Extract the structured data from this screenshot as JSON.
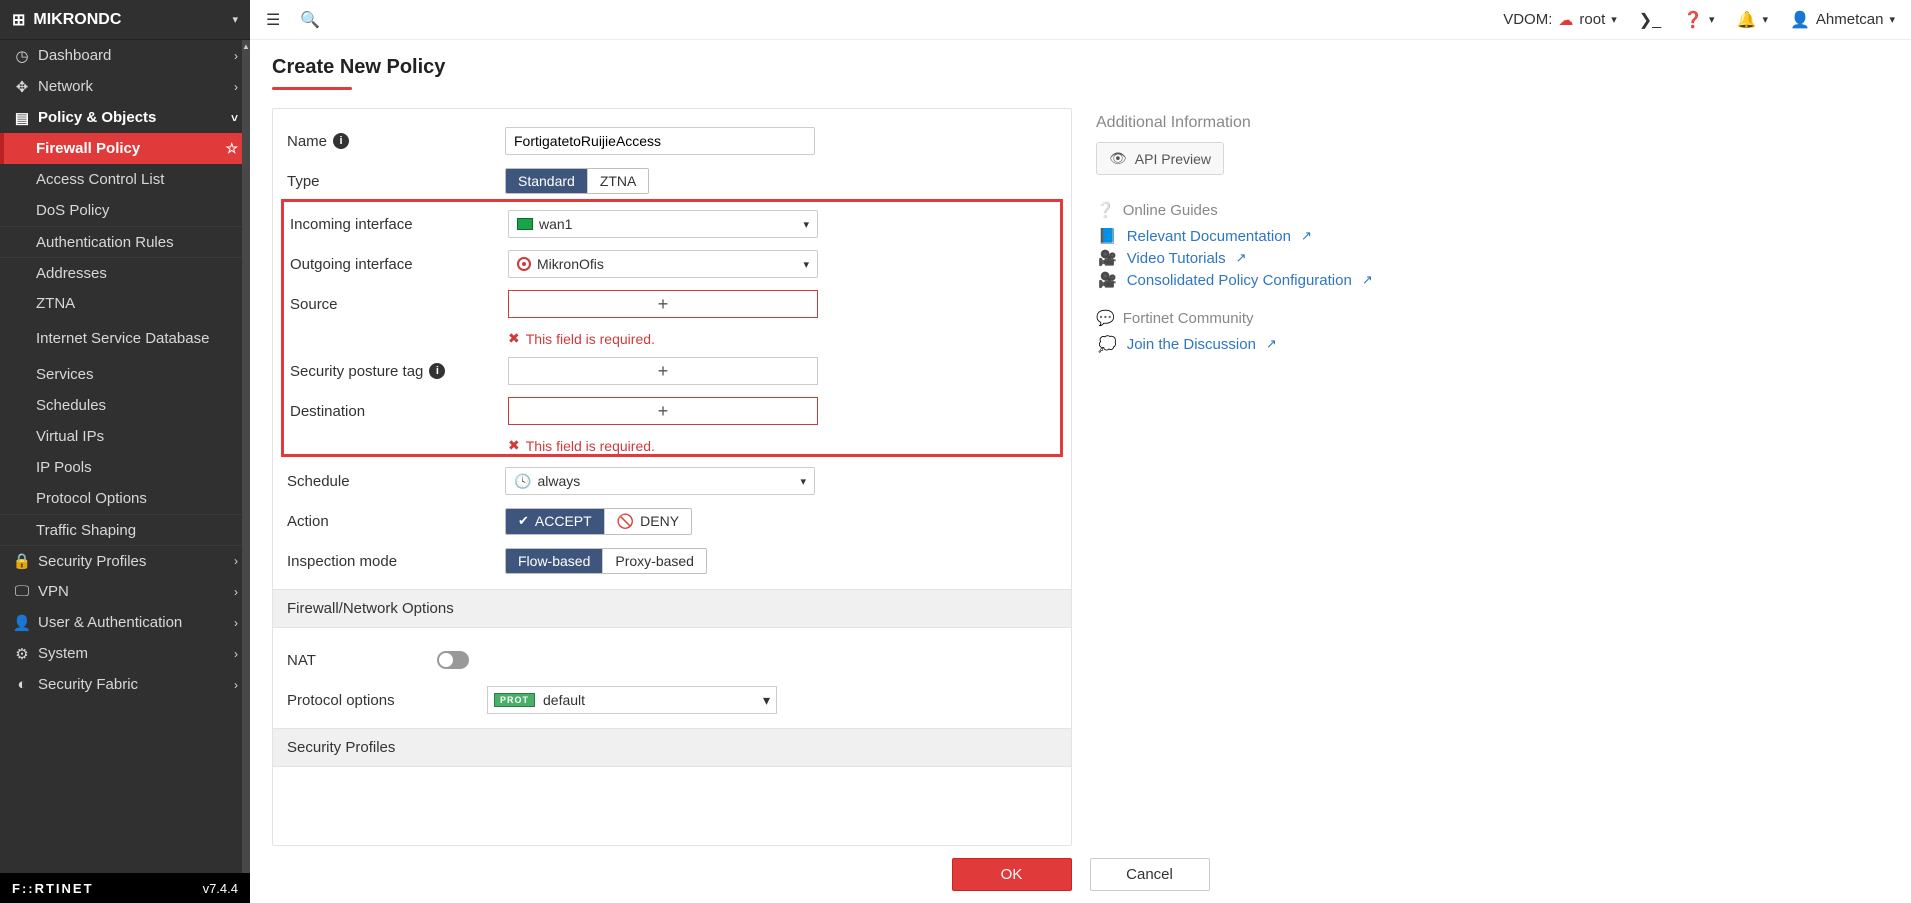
{
  "brand": {
    "name": "MIKRONDC"
  },
  "sidebar": {
    "items": [
      {
        "icon": "🧭",
        "label": "Dashboard",
        "chev": "›"
      },
      {
        "icon": "✥",
        "label": "Network",
        "chev": "›"
      },
      {
        "icon": "🗄",
        "label": "Policy & Objects",
        "chev": "˅",
        "active": true
      },
      {
        "sub": true,
        "label": "Firewall Policy",
        "selected": true,
        "star": true
      },
      {
        "sub": true,
        "label": "Access Control List"
      },
      {
        "sub": true,
        "label": "DoS Policy"
      },
      {
        "sub": true,
        "sep": true,
        "label": "Authentication Rules"
      },
      {
        "sub": true,
        "sep": true,
        "label": "Addresses"
      },
      {
        "sub": true,
        "label": "ZTNA"
      },
      {
        "sub": true,
        "label": "Internet Service Database"
      },
      {
        "sub": true,
        "label": "Services"
      },
      {
        "sub": true,
        "label": "Schedules"
      },
      {
        "sub": true,
        "label": "Virtual IPs"
      },
      {
        "sub": true,
        "label": "IP Pools"
      },
      {
        "sub": true,
        "label": "Protocol Options"
      },
      {
        "sub": true,
        "sep": true,
        "label": "Traffic Shaping"
      },
      {
        "icon": "🔒",
        "label": "Security Profiles",
        "chev": "›",
        "sep": true
      },
      {
        "icon": "💻",
        "label": "VPN",
        "chev": "›"
      },
      {
        "icon": "👤",
        "label": "User & Authentication",
        "chev": "›"
      },
      {
        "icon": "⚙",
        "label": "System",
        "chev": "›"
      },
      {
        "icon": "🌐",
        "label": "Security Fabric",
        "chev": "›"
      }
    ]
  },
  "footer": {
    "logo": "F::RTINET",
    "version": "v7.4.4"
  },
  "topbar": {
    "vdom_label": "VDOM:",
    "vdom_value": "root",
    "user": "Ahmetcan"
  },
  "page": {
    "title": "Create New Policy"
  },
  "form": {
    "name_label": "Name",
    "name_value": "FortigatetoRuijieAccess",
    "type_label": "Type",
    "type_options": {
      "standard": "Standard",
      "ztna": "ZTNA"
    },
    "incoming_label": "Incoming interface",
    "incoming_value": "wan1",
    "outgoing_label": "Outgoing interface",
    "outgoing_value": "MikronOfis",
    "source_label": "Source",
    "required_msg": "This field is required.",
    "posture_label": "Security posture tag",
    "destination_label": "Destination",
    "schedule_label": "Schedule",
    "schedule_value": "always",
    "action_label": "Action",
    "action_options": {
      "accept": "ACCEPT",
      "deny": "DENY"
    },
    "inspection_label": "Inspection mode",
    "inspection_options": {
      "flow": "Flow-based",
      "proxy": "Proxy-based"
    },
    "section_firewall": "Firewall/Network Options",
    "nat_label": "NAT",
    "proto_label": "Protocol options",
    "proto_badge": "PROT",
    "proto_value": "default",
    "section_profiles": "Security Profiles"
  },
  "actions": {
    "ok": "OK",
    "cancel": "Cancel"
  },
  "right": {
    "additional": "Additional Information",
    "api_preview": "API Preview",
    "online_guides": "Online Guides",
    "links": {
      "doc": "Relevant Documentation",
      "video": "Video Tutorials",
      "consolidated": "Consolidated Policy Configuration"
    },
    "community": "Fortinet Community",
    "discussion": "Join the Discussion"
  }
}
